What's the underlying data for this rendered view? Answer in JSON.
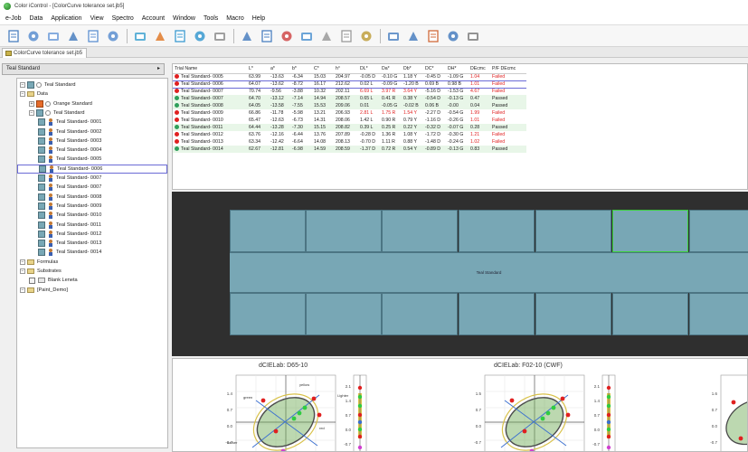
{
  "window": {
    "title": "Color iControl - [ColorCurve tolerance set.jb5]"
  },
  "menu": [
    "e-Job",
    "Data",
    "Application",
    "View",
    "Spectro",
    "Account",
    "Window",
    "Tools",
    "Macro",
    "Help"
  ],
  "toolbar": {
    "icons": [
      "new-job-icon",
      "open-icon",
      "home-icon",
      "print-preview-icon",
      "print-icon",
      "copy-icon",
      "check-icon",
      "sample-tools-icon",
      "measure-icon",
      "refresh-icon",
      "window-icon",
      "compare-icon",
      "compare-2-icon",
      "color-wheel-icon",
      "color-wheel-2-icon",
      "color-dots-icon",
      "color-dots-2-icon",
      "beaker-icon",
      "chart-icon",
      "report-icon",
      "palette-icon",
      "document-icon",
      "stats-icon"
    ]
  },
  "doc_tab": {
    "label": "ColorCurve tolerance set.jb5"
  },
  "left": {
    "standard_select": "Teal Standard",
    "tree": [
      {
        "label": "Teal Standard",
        "kind": "standard",
        "indent": 0
      },
      {
        "label": "Data",
        "kind": "folder",
        "indent": 0
      },
      {
        "label": "Orange Standard",
        "kind": "orange",
        "indent": 1
      },
      {
        "label": "Teal Standard",
        "kind": "standard",
        "indent": 1
      },
      {
        "label": "Teal Standard- 0001",
        "kind": "trial",
        "indent": 2
      },
      {
        "label": "Teal Standard- 0002",
        "kind": "trial",
        "indent": 2
      },
      {
        "label": "Teal Standard- 0003",
        "kind": "trial",
        "indent": 2
      },
      {
        "label": "Teal Standard- 0004",
        "kind": "trial",
        "indent": 2
      },
      {
        "label": "Teal Standard- 0005",
        "kind": "trial",
        "indent": 2
      },
      {
        "label": "Teal Standard- 0006",
        "kind": "trial",
        "indent": 2,
        "selected": true
      },
      {
        "label": "Teal Standard- 0007",
        "kind": "trial",
        "indent": 2
      },
      {
        "label": "Teal Standard- 0007",
        "kind": "trial",
        "indent": 2
      },
      {
        "label": "Teal Standard- 0008",
        "kind": "trial",
        "indent": 2
      },
      {
        "label": "Teal Standard- 0009",
        "kind": "trial",
        "indent": 2
      },
      {
        "label": "Teal Standard- 0010",
        "kind": "trial",
        "indent": 2
      },
      {
        "label": "Teal Standard- 0011",
        "kind": "trial",
        "indent": 2
      },
      {
        "label": "Teal Standard- 0012",
        "kind": "trial",
        "indent": 2
      },
      {
        "label": "Teal Standard- 0013",
        "kind": "trial",
        "indent": 2
      },
      {
        "label": "Teal Standard- 0014",
        "kind": "trial",
        "indent": 2
      },
      {
        "label": "Formulas",
        "kind": "folder",
        "indent": 0
      },
      {
        "label": "Substrates",
        "kind": "folder",
        "indent": 0
      },
      {
        "label": "Blank Leneta",
        "kind": "substrate",
        "indent": 1
      },
      {
        "label": "[Paint_Demo]",
        "kind": "folder",
        "indent": 0
      }
    ]
  },
  "table": {
    "headers": [
      "Trial Name",
      "L*",
      "a*",
      "b*",
      "C*",
      "h°",
      "DL*",
      "Da*",
      "Db*",
      "DC*",
      "DH*",
      "DEcmc",
      "P/F DEcmc"
    ],
    "rows": [
      {
        "cells": [
          "Teal Standard- 0005",
          "63.99",
          "-13.63",
          "-6.34",
          "15.03",
          "204.97",
          "-0.05 D",
          "-0.10 G",
          "1.18 Y",
          "-0.45 D",
          "-1.09 G",
          "1.04",
          "Failed"
        ],
        "status": "fail",
        "red": [
          11,
          12
        ]
      },
      {
        "cells": [
          "Teal Standard- 0006",
          "64.07",
          "-13.62",
          "-8.72",
          "16.17",
          "212.62",
          "0.02 L",
          "-0.09 G",
          "-1.20 B",
          "0.69 B",
          "0.98 B",
          "1.01",
          "Failed"
        ],
        "status": "fail",
        "red": [
          11,
          12
        ],
        "selected": true
      },
      {
        "cells": [
          "Teal Standard- 0007",
          "70.74",
          "-9.56",
          "-3.88",
          "10.32",
          "202.11",
          "6.69 L",
          "3.97 R",
          "3.64 Y",
          "-5.16 D",
          "-1.53 G",
          "4.67",
          "Failed"
        ],
        "status": "fail",
        "red": [
          6,
          7,
          8,
          11,
          12
        ]
      },
      {
        "cells": [
          "Teal Standard- 0007",
          "64.70",
          "-13.12",
          "-7.14",
          "14.94",
          "208.57",
          "0.65 L",
          "0.41 R",
          "0.38 Y",
          "-0.54 D",
          "-0.13 G",
          "0.47",
          "Passed"
        ],
        "status": "pass",
        "red": []
      },
      {
        "cells": [
          "Teal Standard- 0008",
          "64.05",
          "-13.58",
          "-7.55",
          "15.53",
          "209.06",
          "0.01",
          "-0.05 G",
          "-0.02 B",
          "0.06 B",
          "-0.00",
          "0.04",
          "Passed"
        ],
        "status": "pass",
        "red": []
      },
      {
        "cells": [
          "Teal Standard- 0009",
          "66.86",
          "-11.78",
          "-5.98",
          "13.21",
          "206.93",
          "2.81 L",
          "1.75 R",
          "1.54 Y",
          "-2.27 D",
          "-0.54 G",
          "1.99",
          "Failed"
        ],
        "status": "fail",
        "red": [
          6,
          7,
          8,
          11,
          12
        ]
      },
      {
        "cells": [
          "Teal Standard- 0010",
          "65.47",
          "-12.63",
          "-6.73",
          "14.31",
          "208.06",
          "1.42 L",
          "0.90 R",
          "0.79 Y",
          "-1.16 D",
          "-0.26 G",
          "1.01",
          "Failed"
        ],
        "status": "fail",
        "red": [
          11,
          12
        ]
      },
      {
        "cells": [
          "Teal Standard- 0011",
          "64.44",
          "-13.28",
          "-7.30",
          "15.15",
          "208.82",
          "0.39 L",
          "0.25 R",
          "0.22 Y",
          "-0.32 D",
          "-0.07 G",
          "0.28",
          "Passed"
        ],
        "status": "pass",
        "red": []
      },
      {
        "cells": [
          "Teal Standard- 0012",
          "63.76",
          "-12.16",
          "-6.44",
          "13.76",
          "207.89",
          "-0.28 D",
          "1.36 R",
          "1.08 Y",
          "-1.72 D",
          "-0.30 G",
          "1.21",
          "Failed"
        ],
        "status": "fail",
        "red": [
          11,
          12
        ]
      },
      {
        "cells": [
          "Teal Standard- 0013",
          "63.34",
          "-12.42",
          "-6.64",
          "14.08",
          "208.13",
          "-0.70 D",
          "1.11 R",
          "0.88 Y",
          "-1.48 D",
          "-0.24 G",
          "1.02",
          "Failed"
        ],
        "status": "fail",
        "red": [
          11,
          12
        ]
      },
      {
        "cells": [
          "Teal Standard- 0014",
          "62.67",
          "-12.81",
          "-6.98",
          "14.59",
          "208.59",
          "-1.37 D",
          "0.72 R",
          "0.54 Y",
          "-0.89 D",
          "-0.13 G",
          "0.83",
          "Passed"
        ],
        "status": "pass",
        "red": []
      }
    ]
  },
  "swatches": {
    "center_label": "Teal Standard",
    "color": "#78a7b5"
  },
  "plots": {
    "left_title": "dCIELab: D65-10",
    "right_title": "dCIELab: F02-10 (CWF)",
    "left_plot": {
      "ticks_y": [
        "1.4",
        "0.7",
        "0.0",
        "-0.7",
        "-1.4"
      ],
      "labels": [
        "green",
        "red",
        "yellow",
        "blue",
        "Lighter",
        "darker"
      ],
      "l_scale_ticks": [
        "2.1",
        "1.4",
        "0.7",
        "0.0",
        "-0.7"
      ]
    },
    "right_plot": {
      "ticks_y": [
        "1.5",
        "0.7",
        "0.0",
        "-0.7",
        "-1.4"
      ],
      "l_scale_ticks": [
        "2.1",
        "1.4",
        "0.7",
        "0.0",
        "-0.7"
      ]
    },
    "third_plot": {
      "ticks_y": [
        "1.6",
        "0.7",
        "0.0",
        "-0.7"
      ]
    }
  },
  "colors": {
    "fail": "#e02020",
    "pass": "#2e9e5a",
    "teal": "#78a7b5",
    "selection": "#6b6bd6"
  }
}
